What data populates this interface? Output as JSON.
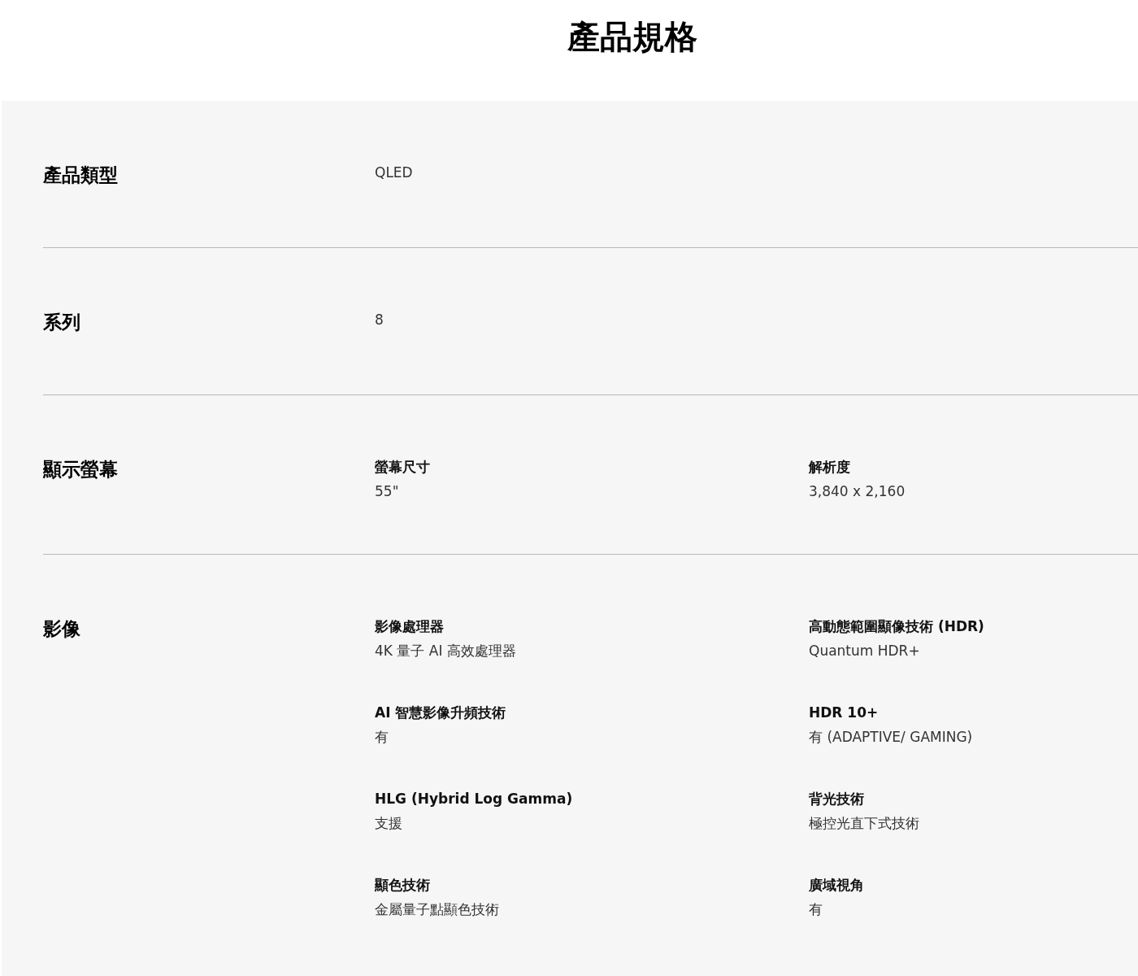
{
  "title": "產品規格",
  "sections": [
    {
      "title": "產品類型",
      "specs": [
        {
          "value": "QLED"
        }
      ]
    },
    {
      "title": "系列",
      "specs": [
        {
          "value": "8"
        }
      ]
    },
    {
      "title": "顯示螢幕",
      "specs": [
        {
          "label": "螢幕尺寸",
          "value": "55\""
        },
        {
          "label": "解析度",
          "value": "3,840 x 2,160"
        }
      ]
    },
    {
      "title": "影像",
      "specs": [
        {
          "label": "影像處理器",
          "value": "4K 量子 AI 高效處理器"
        },
        {
          "label": "高動態範圍顯像技術 (HDR)",
          "value": "Quantum HDR+"
        },
        {
          "label": "AI 智慧影像升頻技術",
          "value": "有"
        },
        {
          "label": "HDR 10+",
          "value": "有 (ADAPTIVE/ GAMING)"
        },
        {
          "label": "HLG (Hybrid Log Gamma)",
          "value": "支援"
        },
        {
          "label": "背光技術",
          "value": "極控光直下式技術"
        },
        {
          "label": "顯色技術",
          "value": "金屬量子點顯色技術"
        },
        {
          "label": "廣域視角",
          "value": "有"
        }
      ]
    }
  ]
}
